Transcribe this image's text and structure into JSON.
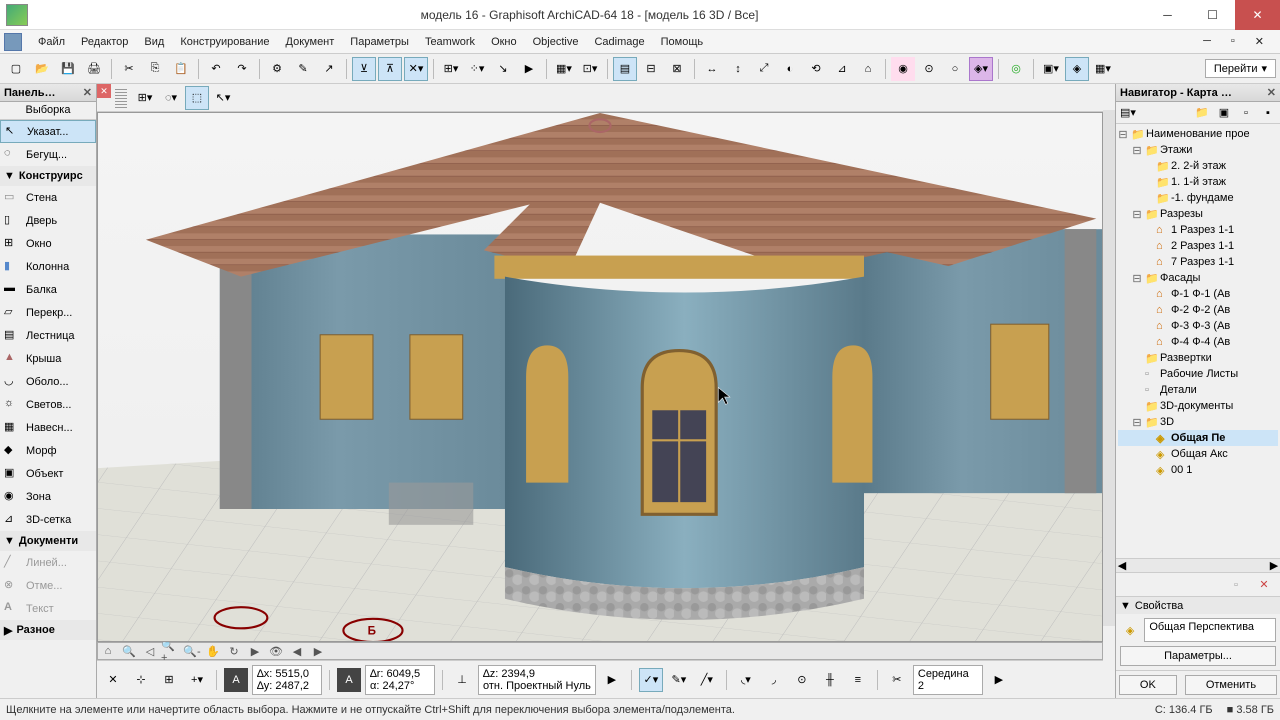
{
  "title": "модель 16 - Graphisoft ArchiCAD-64 18 - [модель 16 3D / Все]",
  "menu": [
    "Файл",
    "Редактор",
    "Вид",
    "Конструирование",
    "Документ",
    "Параметры",
    "Teamwork",
    "Окно",
    "Objective",
    "Cadimage",
    "Помощь"
  ],
  "go_btn": "Перейти",
  "left_panel": {
    "title": "Панель…",
    "subtitle": "Выборка",
    "pointer": "Указат...",
    "marquee": "Бегущ...",
    "cat_construct": "Конструирс",
    "tools": [
      "Стена",
      "Дверь",
      "Окно",
      "Колонна",
      "Балка",
      "Перекр...",
      "Лестница",
      "Крыша",
      "Оболо...",
      "Светов...",
      "Навесн...",
      "Морф",
      "Объект",
      "Зона",
      "3D-сетка"
    ],
    "cat_doc": "Документи",
    "doc_tools": [
      "Линей...",
      "Отме...",
      "Текст"
    ],
    "cat_more": "Разное"
  },
  "navigator": {
    "title": "Навигатор - Карта …",
    "root": "Наименование прое",
    "stories": "Этажи",
    "story_items": [
      "2. 2-й этаж",
      "1. 1-й этаж",
      "-1. фундаме"
    ],
    "sections": "Разрезы",
    "section_items": [
      "1 Разрез 1-1",
      "2 Разрез 1-1",
      "7 Разрез 1-1"
    ],
    "elevations": "Фасады",
    "elev_items": [
      "Ф-1 Ф-1 (Ав",
      "Ф-2 Ф-2 (Ав",
      "Ф-3 Ф-3 (Ав",
      "Ф-4 Ф-4 (Ав"
    ],
    "interior": "Развертки",
    "worksheets": "Рабочие Листы",
    "details": "Детали",
    "docs3d": "3D-документы",
    "three_d": "3D",
    "three_d_items": [
      "Общая Пе",
      "Общая Акс",
      "00 1"
    ],
    "props_title": "Свойства",
    "props_combo": "Общая Перспектива",
    "params_btn": "Параметры...",
    "ok": "OK",
    "cancel": "Отменить"
  },
  "coords": {
    "dx": "∆x: 5515,0",
    "dy": "∆y: 2487,2",
    "dr": "∆r: 6049,5",
    "ang": "α: 24,27°",
    "dz": "∆z: 2394,9",
    "rel": "отн. Проектный Нуль",
    "snap": "Середина",
    "snap_num": "2"
  },
  "status": {
    "hint": "Щелкните на элементе или начертите область выбора. Нажмите и не отпускайте Ctrl+Shift для переключения выбора элемента/подэлемента.",
    "mem1": "C: 136.4 ГБ",
    "mem2": "■ 3.58 ГБ"
  }
}
